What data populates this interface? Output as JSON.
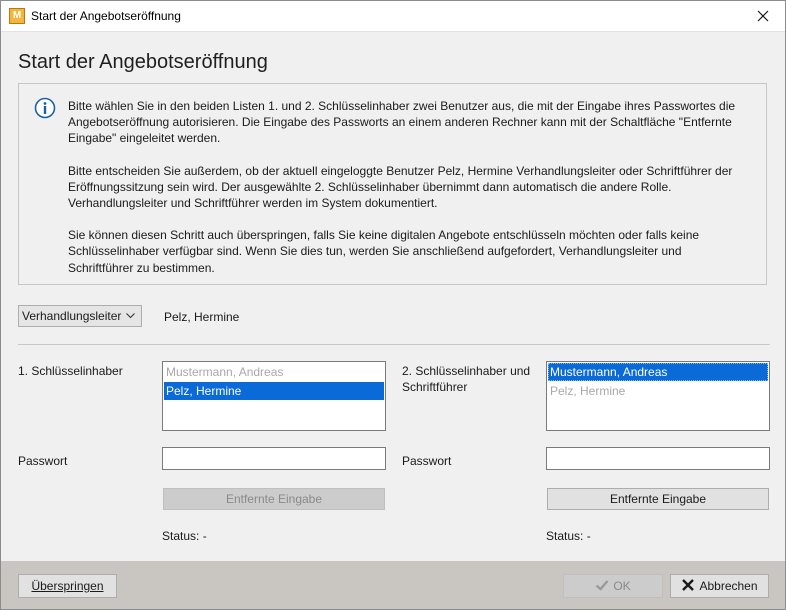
{
  "window": {
    "title": "Start der Angebotseröffnung",
    "app_icon_letter": "M"
  },
  "heading": "Start der Angebotseröffnung",
  "info": {
    "paragraph_1": "Bitte wählen Sie in den beiden Listen 1. und 2. Schlüsselinhaber zwei Benutzer aus, die mit der Eingabe ihres Passwortes die Angebotseröffnung autorisieren. Die Eingabe des Passworts an einem anderen Rechner kann mit der Schaltfläche \"Entfernte Eingabe\" eingeleitet werden.",
    "paragraph_2": "Bitte entscheiden Sie außerdem, ob der aktuell eingeloggte Benutzer Pelz, Hermine Verhandlungsleiter oder Schriftführer der Eröffnungssitzung sein wird. Der ausgewählte 2. Schlüsselinhaber übernimmt dann automatisch die andere Rolle. Verhandlungsleiter und Schriftführer werden im System dokumentiert.",
    "paragraph_3": "Sie können diesen Schritt auch überspringen, falls Sie keine digitalen Angebote entschlüsseln möchten oder falls keine Schlüsselinhaber verfügbar sind. Wenn Sie dies tun, werden Sie anschließend aufgefordert, Verhandlungsleiter und Schriftführer zu bestimmen."
  },
  "role": {
    "selected": "Verhandlungsleiter",
    "current_user": "Pelz, Hermine"
  },
  "key_holder_1": {
    "label": "1. Schlüsselinhaber",
    "items": [
      {
        "name": "Mustermann, Andreas",
        "state": "disabled"
      },
      {
        "name": "Pelz, Hermine",
        "state": "selected"
      }
    ],
    "password_label": "Passwort",
    "password_value": "",
    "remote_button": "Entfernte Eingabe",
    "status": "Status: -"
  },
  "key_holder_2": {
    "label_line1": "2. Schlüsselinhaber und",
    "label_line2": "Schriftführer",
    "items": [
      {
        "name": "Mustermann, Andreas",
        "state": "selected"
      },
      {
        "name": "Pelz, Hermine",
        "state": "disabled"
      }
    ],
    "password_label": "Passwort",
    "password_value": "",
    "remote_button": "Entfernte Eingabe",
    "status": "Status: -"
  },
  "footer": {
    "skip_button": "Überspringen",
    "ok_button": "OK",
    "cancel_button": "Abbrechen"
  },
  "colors": {
    "selection": "#0a6ad8",
    "footer_bg": "#c9c6c2",
    "info_icon": "#1c5fa8",
    "cancel_x": "#1a1a1a"
  },
  "icons": {
    "app": "app-logo-icon",
    "close": "close-icon",
    "info": "info-icon",
    "dropdown": "chevron-down-icon",
    "ok": "checkmark-icon",
    "cancel": "x-icon"
  }
}
